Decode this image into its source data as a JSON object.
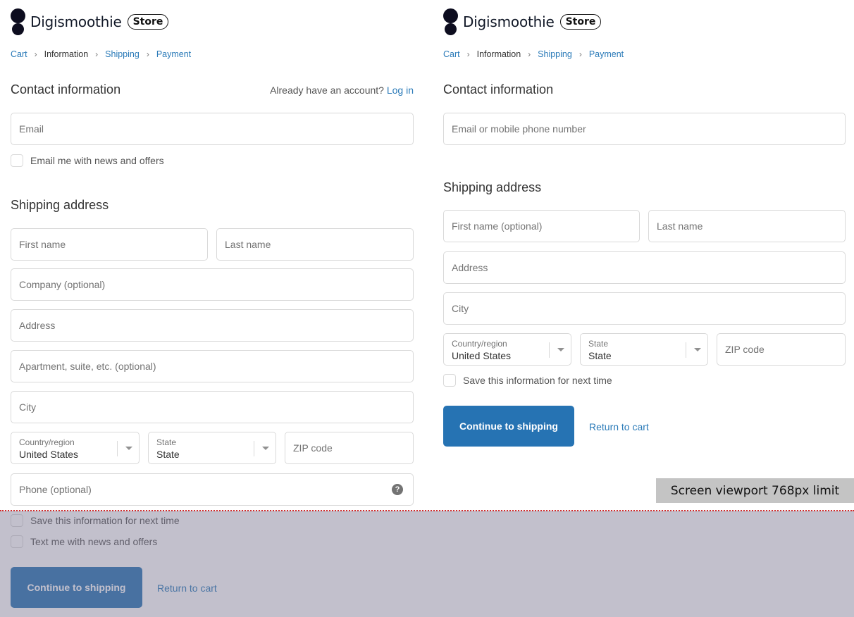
{
  "left": {
    "brand": {
      "name": "Digismoothie",
      "badge": "Store"
    },
    "breadcrumb": [
      {
        "label": "Cart",
        "state": "link"
      },
      {
        "label": "Information",
        "state": "current"
      },
      {
        "label": "Shipping",
        "state": "link"
      },
      {
        "label": "Payment",
        "state": "link"
      }
    ],
    "breadcrumb_separator": ">",
    "contact": {
      "title": "Contact information",
      "account_prompt": "Already have an account?",
      "login_link": "Log in",
      "email_placeholder": "Email",
      "newsletter_label": "Email me with news and offers"
    },
    "shipping": {
      "title": "Shipping address",
      "first_name_placeholder": "First name",
      "last_name_placeholder": "Last name",
      "company_placeholder": "Company (optional)",
      "address_placeholder": "Address",
      "apartment_placeholder": "Apartment, suite, etc. (optional)",
      "city_placeholder": "City",
      "country_label": "Country/region",
      "country_value": "United States",
      "state_label": "State",
      "state_value": "State",
      "zip_placeholder": "ZIP code",
      "phone_placeholder": "Phone (optional)",
      "phone_help_icon": "?",
      "save_info_label": "Save this information for next time",
      "text_offers_label": "Text me with news and offers"
    },
    "actions": {
      "continue_label": "Continue to shipping",
      "return_label": "Return to cart"
    }
  },
  "right": {
    "brand": {
      "name": "Digismoothie",
      "badge": "Store"
    },
    "breadcrumb": [
      {
        "label": "Cart",
        "state": "link"
      },
      {
        "label": "Information",
        "state": "current"
      },
      {
        "label": "Shipping",
        "state": "link"
      },
      {
        "label": "Payment",
        "state": "link"
      }
    ],
    "breadcrumb_separator": ">",
    "contact": {
      "title": "Contact information",
      "email_placeholder": "Email or mobile phone number"
    },
    "shipping": {
      "title": "Shipping address",
      "first_name_placeholder": "First name (optional)",
      "last_name_placeholder": "Last name",
      "address_placeholder": "Address",
      "city_placeholder": "City",
      "country_label": "Country/region",
      "country_value": "United States",
      "state_label": "State",
      "state_value": "State",
      "zip_placeholder": "ZIP code",
      "save_info_label": "Save this information for next time"
    },
    "actions": {
      "continue_label": "Continue to shipping",
      "return_label": "Return to cart"
    }
  },
  "annotation": {
    "viewport_label": "Screen viewport 768px limit"
  },
  "colors": {
    "accent": "#2673b3",
    "link": "#2a7ab8",
    "viewport_line": "#d12b2b"
  }
}
